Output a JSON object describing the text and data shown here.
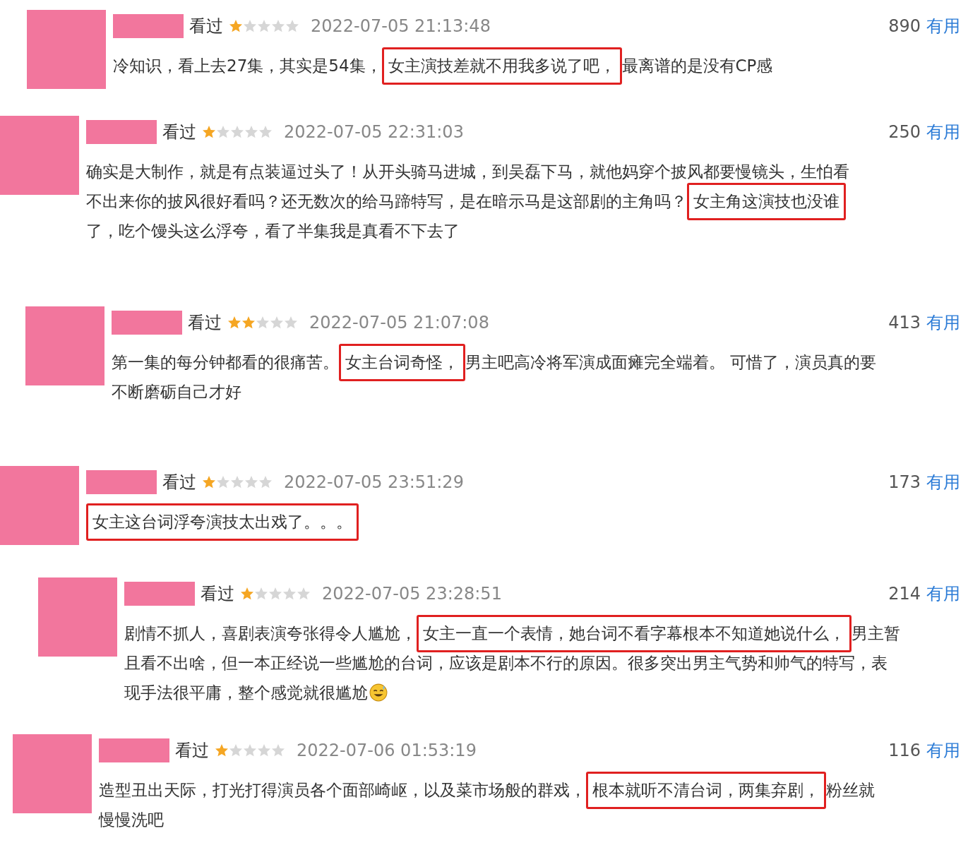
{
  "reviews": [
    {
      "status": "看过",
      "stars": 1,
      "time": "2022-07-05 21:13:48",
      "useful_count": "890",
      "useful_label": "有用",
      "lines": [
        [
          {
            "text": "冷知识，看上去27集，其实是54集，",
            "highlighted": false
          },
          {
            "text": "女主演技差就不用我多说了吧，",
            "highlighted": true
          },
          {
            "text": "最离谱的是没有CP感",
            "highlighted": false
          }
        ]
      ]
    },
    {
      "status": "看过",
      "stars": 1,
      "time": "2022-07-05 22:31:03",
      "useful_count": "250",
      "useful_label": "有用",
      "lines": [
        [
          {
            "text": "确实是大制作，就是有点装逼过头了！从开头骑马进城，到吴磊下马，就他妈穿个披风都要慢镜头，生怕看",
            "highlighted": false
          }
        ],
        [
          {
            "text": "不出来你的披风很好看吗？还无数次的给马蹄特写，是在暗示马是这部剧的主角吗？",
            "highlighted": false
          },
          {
            "text": "女主角这演技也没谁",
            "highlighted": true
          }
        ],
        [
          {
            "text": "了，吃个馒头这么浮夸，看了半集我是真看不下去了",
            "highlighted": false
          }
        ]
      ]
    },
    {
      "status": "看过",
      "stars": 2,
      "time": "2022-07-05 21:07:08",
      "useful_count": "413",
      "useful_label": "有用",
      "lines": [
        [
          {
            "text": "第一集的每分钟都看的很痛苦。",
            "highlighted": false
          },
          {
            "text": "女主台词奇怪，",
            "highlighted": true
          },
          {
            "text": "男主吧高冷将军演成面瘫完全端着。 可惜了，演员真的要",
            "highlighted": false
          }
        ],
        [
          {
            "text": "不断磨砺自己才好",
            "highlighted": false
          }
        ]
      ]
    },
    {
      "status": "看过",
      "stars": 1,
      "time": "2022-07-05 23:51:29",
      "useful_count": "173",
      "useful_label": "有用",
      "lines": [
        [
          {
            "text": "女主这台词浮夸演技太出戏了。。。",
            "highlighted": true
          }
        ]
      ]
    },
    {
      "status": "看过",
      "stars": 1,
      "time": "2022-07-05 23:28:51",
      "useful_count": "214",
      "useful_label": "有用",
      "emoji": true,
      "lines": [
        [
          {
            "text": "剧情不抓人，喜剧表演夸张得令人尴尬，",
            "highlighted": false
          },
          {
            "text": "女主一直一个表情，她台词不看字幕根本不知道她说什么，",
            "highlighted": true
          },
          {
            "text": "男主暂",
            "highlighted": false
          }
        ],
        [
          {
            "text": "且看不出啥，但一本正经说一些尴尬的台词，应该是剧本不行的原因。很多突出男主气势和帅气的特写，表",
            "highlighted": false
          }
        ],
        [
          {
            "text": "现手法很平庸，整个感觉就很尴尬",
            "highlighted": false
          }
        ]
      ]
    },
    {
      "status": "看过",
      "stars": 1,
      "time": "2022-07-06 01:53:19",
      "useful_count": "116",
      "useful_label": "有用",
      "lines": [
        [
          {
            "text": "造型丑出天际，打光打得演员各个面部崎岖，以及菜市场般的群戏，",
            "highlighted": false
          },
          {
            "text": "根本就听不清台词，两集弃剧，",
            "highlighted": true
          },
          {
            "text": "粉丝就",
            "highlighted": false
          }
        ],
        [
          {
            "text": "慢慢洗吧",
            "highlighted": false
          }
        ]
      ]
    }
  ]
}
